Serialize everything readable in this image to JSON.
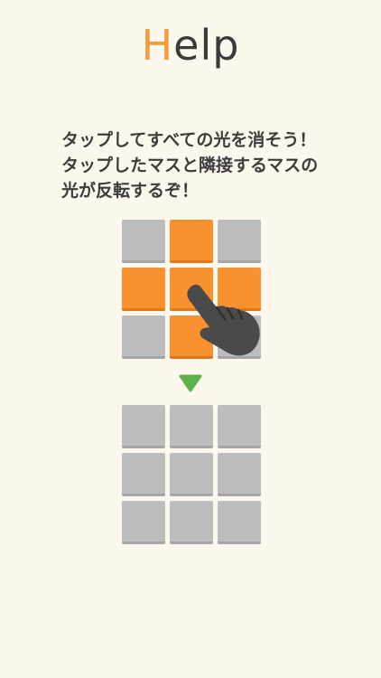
{
  "title": {
    "first_letter": "H",
    "rest": "elp"
  },
  "instructions": [
    "タップしてすべての光を消そう！",
    "タップしたマスと隣接するマスの",
    "光が反転するぞ！"
  ],
  "before_grid": [
    [
      "off",
      "on",
      "off"
    ],
    [
      "on",
      "on",
      "on"
    ],
    [
      "off",
      "on",
      "off"
    ]
  ],
  "after_grid": [
    [
      "off",
      "off",
      "off"
    ],
    [
      "off",
      "off",
      "off"
    ],
    [
      "off",
      "off",
      "off"
    ]
  ],
  "colors": {
    "background": "#fdf8ee",
    "light_on": "#f9922e",
    "light_off": "#bdbdbd",
    "arrow": "#5cb24c",
    "title_accent": "#f59b3c",
    "hand": "#4a4a4a"
  },
  "icons": {
    "arrow": "down-triangle-icon",
    "hand": "tap-hand-icon"
  },
  "tapped_cell": {
    "row": 1,
    "col": 1
  }
}
